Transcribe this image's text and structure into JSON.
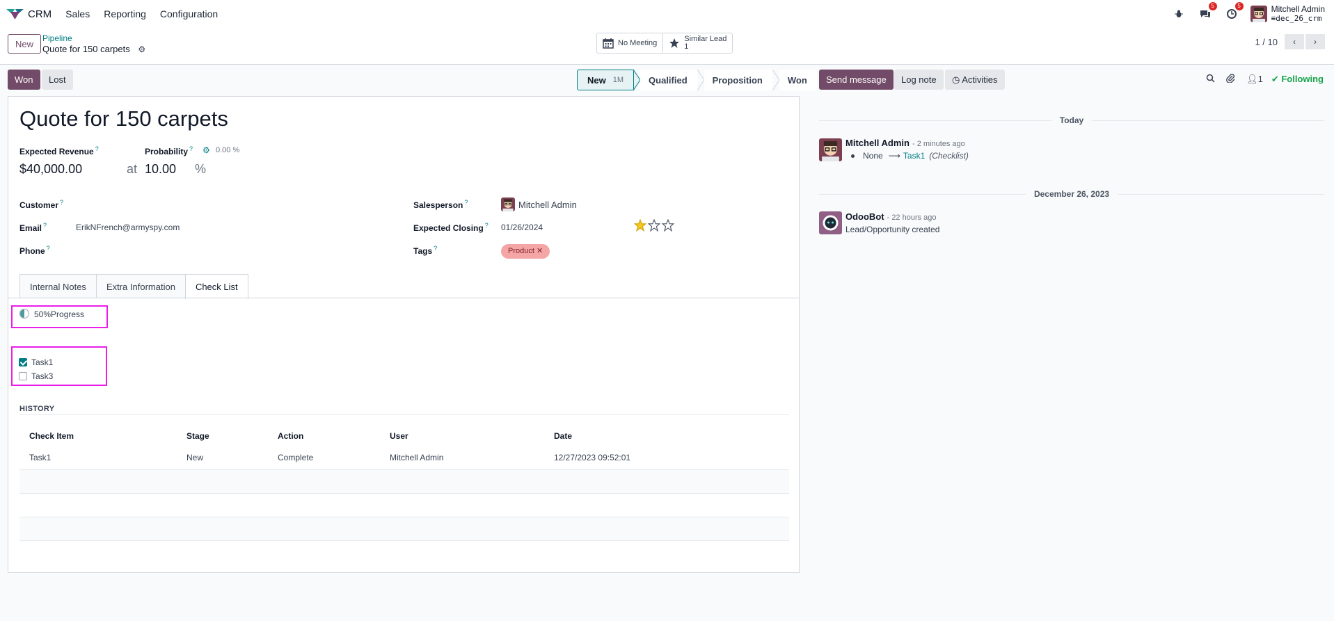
{
  "topbar": {
    "app_name": "CRM",
    "menu": [
      "Sales",
      "Reporting",
      "Configuration"
    ],
    "messages_badge": "5",
    "activities_badge": "5",
    "user_name": "Mitchell Admin",
    "database": "dec_26_crm"
  },
  "control": {
    "new_label": "New",
    "breadcrumb_parent": "Pipeline",
    "breadcrumb_current": "Quote for 150 carpets",
    "smart_meeting": "No Meeting",
    "smart_similar_label": "Similar Lead",
    "smart_similar_count": "1",
    "pager": "1 / 10"
  },
  "status": {
    "won_label": "Won",
    "lost_label": "Lost",
    "stages": [
      {
        "name": "New",
        "count": "1M"
      },
      {
        "name": "Qualified"
      },
      {
        "name": "Proposition"
      },
      {
        "name": "Won"
      }
    ]
  },
  "form": {
    "title": "Quote for 150 carpets",
    "expected_revenue_label": "Expected Revenue",
    "expected_revenue": "$40,000.00",
    "at": "at",
    "probability_label": "Probability",
    "probability_auto": "0.00 %",
    "probability": "10.00",
    "percent": "%",
    "customer_label": "Customer",
    "email_label": "Email",
    "email": "ErikNFrench@armyspy.com",
    "phone_label": "Phone",
    "salesperson_label": "Salesperson",
    "salesperson": "Mitchell Admin",
    "expected_closing_label": "Expected Closing",
    "expected_closing": "01/26/2024",
    "priority_stars": 1,
    "tags_label": "Tags",
    "tags": [
      "Product"
    ],
    "help_mark": "?"
  },
  "tabs": [
    "Internal Notes",
    "Extra Information",
    "Check List"
  ],
  "checklist": {
    "progress_value": 0.5,
    "progress_text": "50%Progress",
    "items": [
      {
        "label": "Task1",
        "checked": true
      },
      {
        "label": "Task3",
        "checked": false
      }
    ]
  },
  "history": {
    "title": "HISTORY",
    "columns": [
      "Check Item",
      "Stage",
      "Action",
      "User",
      "Date"
    ],
    "rows": [
      [
        "Task1",
        "New",
        "Complete",
        "Mitchell Admin",
        "12/27/2023 09:52:01"
      ]
    ]
  },
  "chatter": {
    "send_message": "Send message",
    "log_note": "Log note",
    "activities": "Activities",
    "followers_count": "1",
    "following": "Following",
    "date_today": "Today",
    "date_older": "December 26, 2023",
    "messages": [
      {
        "author": "Mitchell Admin",
        "time": "- 2 minutes ago",
        "tracking_old": "None",
        "tracking_arrow": "⟶",
        "tracking_new": "Task1",
        "tracking_field": "(Checklist)"
      },
      {
        "author": "OdooBot",
        "time": "- 22 hours ago",
        "body": "Lead/Opportunity created"
      }
    ]
  },
  "colors": {
    "brand": "#714b67",
    "accent": "#017e84",
    "highlight": "#e91ee9",
    "following": "#16a34a"
  }
}
